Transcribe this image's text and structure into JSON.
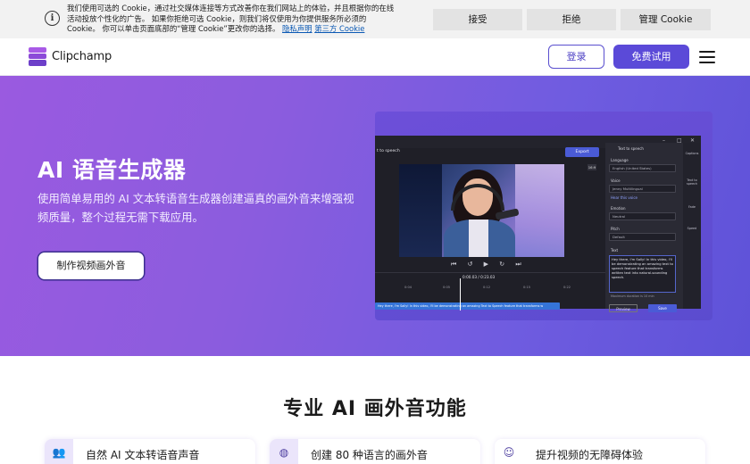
{
  "cookie": {
    "text": "我们使用可选的 Cookie，通过社交媒体连接等方式改善你在我们网站上的体验，并且根据你的在线活动投放个性化的广告。 如果你拒绝可选 Cookie，则我们将仅使用为你提供服务所必须的 Cookie。 你可以单击页面底部的“管理 Cookie”更改你的选择。",
    "privacy_link": "隐私声明",
    "third_party_link": "第三方 Cookie",
    "accept": "接受",
    "reject": "拒绝",
    "manage": "管理 Cookie"
  },
  "nav": {
    "brand": "Clipchamp",
    "login": "登录",
    "free_trial": "免费试用"
  },
  "hero": {
    "title": "AI 语音生成器",
    "description": "使用简单易用的 AI 文本转语音生成器创建逼真的画外音来增强视频质量，整个过程无需下载应用。",
    "cta": "制作视频画外音"
  },
  "editor": {
    "tab_label": "t to speech",
    "export": "Export",
    "ratio": "16:9",
    "timecode": "0:00.03 / 0:23.03",
    "ruler": [
      "0:04",
      "0:05",
      "0:12",
      "0:15",
      "0:22"
    ],
    "track_text": "Hey there, I'm Sally! In this video, I'll be demonstrating an amazing Text to Speech feature that transforms w",
    "panel_title": "Text to speech",
    "language_label": "Language",
    "language_value": "English (United States)",
    "voice_label": "Voice",
    "voice_value": "Jenny Multilingual",
    "hear_voice": "Hear this voice",
    "emotion_label": "Emotion",
    "emotion_value": "Neutral",
    "pitch_label": "Pitch",
    "pitch_value": "Default",
    "text_label": "Text",
    "text_value": "Hey there, I'm Sally! In this video, I'll be demonstrating an amazing text to speech feature that transforms written text into natural-sounding speech.",
    "duration": "Maximum duration is 10 min",
    "preview": "Preview",
    "save": "Save",
    "rail": [
      "Captions",
      "Text to speech",
      "Fade",
      "Speed"
    ]
  },
  "features": {
    "title": "专业 AI 画外音功能",
    "cards": [
      {
        "label": "自然 AI 文本转语音声音",
        "icon": "people-icon"
      },
      {
        "label": "创建 80 种语言的画外音",
        "icon": "globe-icon"
      },
      {
        "label": "提升视频的无障碍体验",
        "icon": "smile-icon"
      }
    ]
  },
  "colors": {
    "primary": "#5b4ad8",
    "hero_start": "#9a5ae0",
    "hero_end": "#5e52d8"
  }
}
